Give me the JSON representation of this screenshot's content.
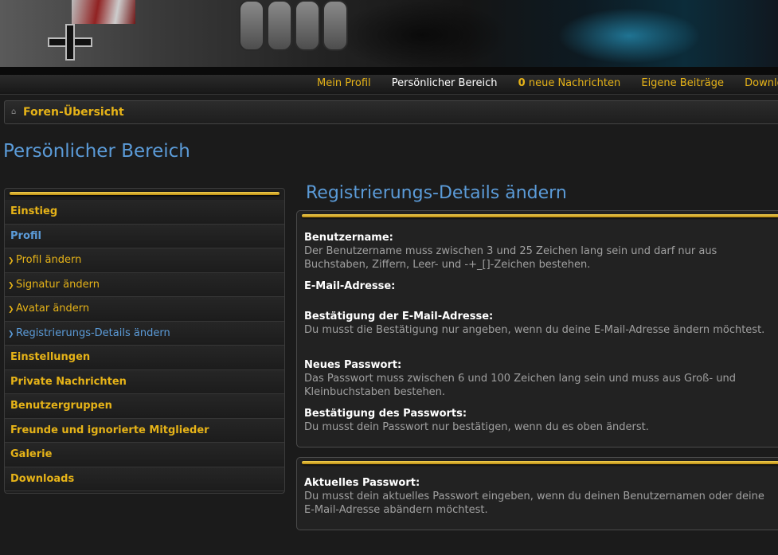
{
  "nav": {
    "items": [
      {
        "label": "Mein Profil",
        "active": false
      },
      {
        "label": "Persönlicher Bereich",
        "active": true
      },
      {
        "count": "0",
        "label": "neue Nachrichten",
        "active": false
      },
      {
        "label": "Eigene Beiträge",
        "active": false
      },
      {
        "label": "Downloads",
        "active": false
      }
    ]
  },
  "breadcrumb": {
    "label": "Foren-Übersicht",
    "icon": "home-icon"
  },
  "page_title": "Persönlicher Bereich",
  "sidebar": {
    "items": [
      {
        "label": "Einstieg"
      },
      {
        "label": "Profil"
      },
      {
        "label": "Profil ändern"
      },
      {
        "label": "Signatur ändern"
      },
      {
        "label": "Avatar ändern"
      },
      {
        "label": "Registrierungs-Details ändern"
      },
      {
        "label": "Einstellungen"
      },
      {
        "label": "Private Nachrichten"
      },
      {
        "label": "Benutzergruppen"
      },
      {
        "label": "Freunde und ignorierte Mitglieder"
      },
      {
        "label": "Galerie"
      },
      {
        "label": "Downloads"
      }
    ]
  },
  "main": {
    "title": "Registrierungs-Details ändern",
    "fields": [
      {
        "label": "Benutzername:",
        "desc": "Der Benutzername muss zwischen 3 und 25 Zeichen lang sein und darf nur aus Buchstaben, Ziffern, Leer- und -+_[]-Zeichen bestehen."
      },
      {
        "label": "E-Mail-Adresse:",
        "desc": ""
      },
      {
        "label": "Bestätigung der E-Mail-Adresse:",
        "desc": "Du musst die Bestätigung nur angeben, wenn du deine E-Mail-Adresse ändern möchtest."
      },
      {
        "label": "Neues Passwort:",
        "desc": "Das Passwort muss zwischen 6 und 100 Zeichen lang sein und muss aus Groß- und Kleinbuchstaben bestehen."
      },
      {
        "label": "Bestätigung des Passworts:",
        "desc": "Du musst dein Passwort nur bestätigen, wenn du es oben änderst."
      }
    ],
    "current_password": {
      "label": "Aktuelles Passwort:",
      "desc": "Du musst dein aktuelles Passwort eingeben, wenn du deinen Benutzernamen oder deine E-Mail-Adresse abändern möchtest."
    }
  },
  "colors": {
    "accent": "#e6b318",
    "link_blue": "#5b9bd8",
    "background": "#1b1b1b"
  }
}
